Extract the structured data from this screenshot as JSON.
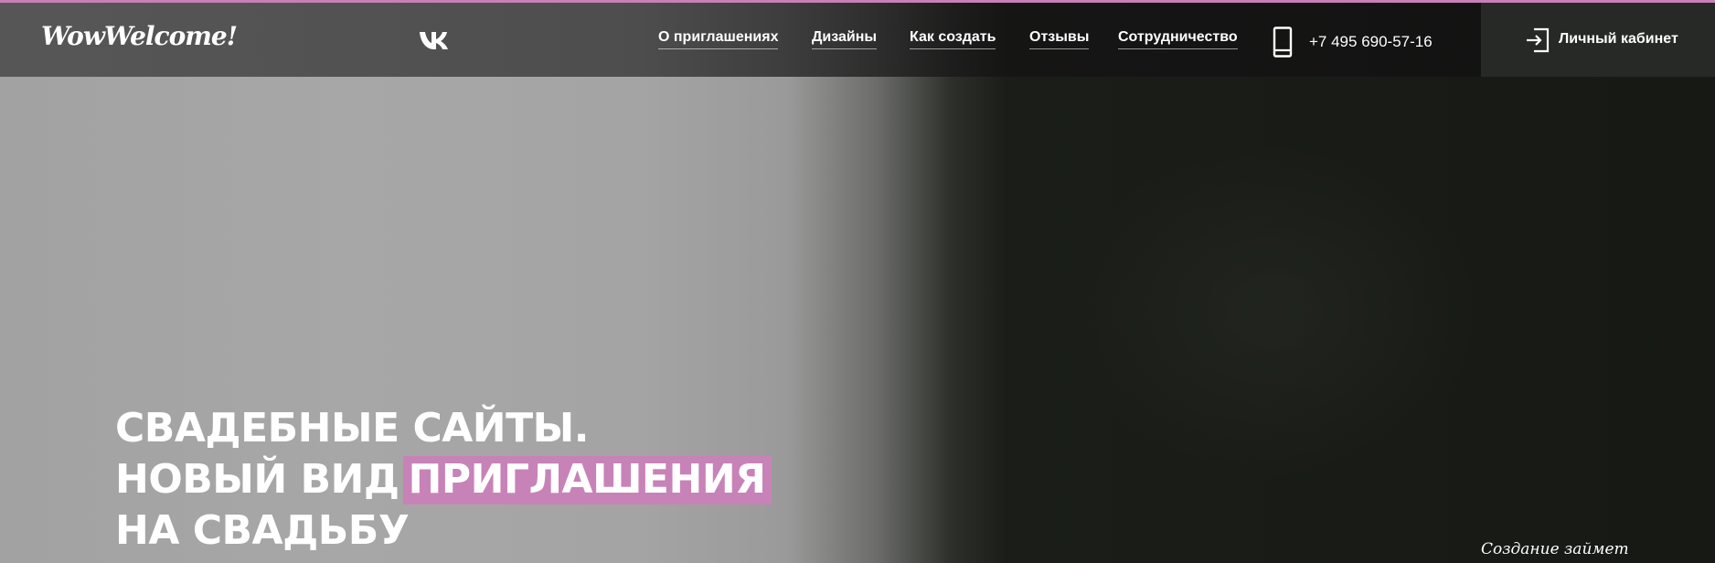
{
  "brand": {
    "logo_text": "WowWelcome!"
  },
  "header": {
    "social_icon": "vk-icon",
    "nav": [
      {
        "label": "О приглашениях"
      },
      {
        "label": "Дизайны"
      },
      {
        "label": "Как создать"
      },
      {
        "label": "Отзывы"
      },
      {
        "label": "Сотрудничество"
      }
    ],
    "phone_icon": "mobile-phone-icon",
    "phone": "+7 495 690-57-16",
    "cabinet_icon": "login-icon",
    "cabinet_label": "Личный кабинет"
  },
  "hero": {
    "title_line1": "СВАДЕБНЫЕ САЙТЫ.",
    "title_line2_prefix": "НОВЫЙ ВИД",
    "title_line2_highlight": "ПРИГЛАШЕНИЯ",
    "title_line3": "НА СВАДЬБУ",
    "corner_note": "Создание займет"
  },
  "colors": {
    "accent": "#c783b8",
    "top_line": "#c97fb8",
    "header_bg": "#3e3e3e",
    "cabinet_bg": "#262926"
  }
}
